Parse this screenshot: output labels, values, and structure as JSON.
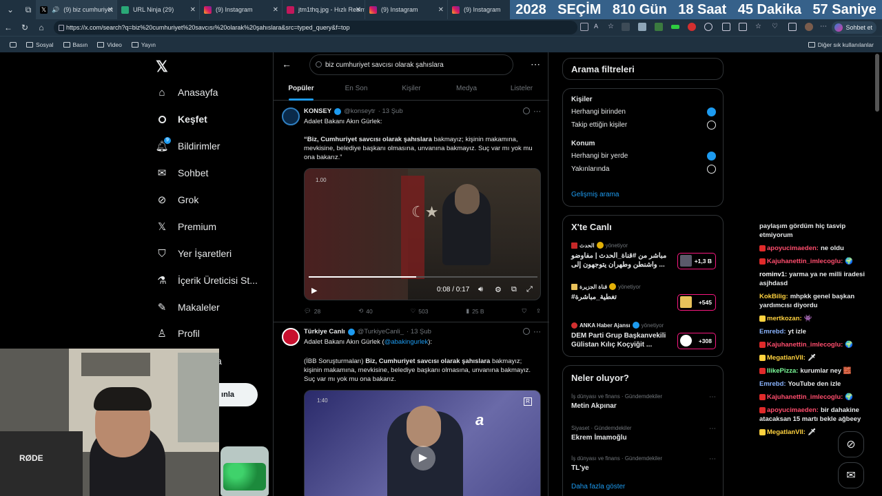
{
  "browser": {
    "tabs": [
      {
        "label": "(9) biz cumhuriyet",
        "favicon": "x-logo",
        "active": true
      },
      {
        "label": "URL Ninja (29)",
        "favicon": "urlninja-icon"
      },
      {
        "label": "(9) Instagram",
        "favicon": "instagram-icon"
      },
      {
        "label": "jtm1thq.jpg - Hızlı Resim",
        "favicon": "image-icon"
      },
      {
        "label": "(9) Instagram",
        "favicon": "instagram-icon"
      },
      {
        "label": "(9) Instagram",
        "favicon": "instagram-icon"
      }
    ],
    "url": "https://x.com/search?q=biz%20cumhuriyet%20savcısı%20olarak%20şahıslara&src=typed_query&f=top",
    "sohbet_label": "Sohbet et",
    "bookmarks": [
      "Sosyal",
      "Basın",
      "Video",
      "Yayın"
    ],
    "other_bookmarks": "Diğer sık kullanılanlar"
  },
  "countdown": {
    "year": "2028",
    "label": "SEÇİM",
    "days": "810 Gün",
    "hours": "18 Saat",
    "minutes": "45 Dakika",
    "seconds": "57 Saniye"
  },
  "nav": {
    "items": [
      {
        "label": "Anasayfa",
        "icon": "home-icon"
      },
      {
        "label": "Keşfet",
        "icon": "search-icon"
      },
      {
        "label": "Bildirimler",
        "icon": "bell-icon",
        "badge": "9"
      },
      {
        "label": "Sohbet",
        "icon": "mail-icon"
      },
      {
        "label": "Grok",
        "icon": "grok-icon"
      },
      {
        "label": "Premium",
        "icon": "x-icon"
      },
      {
        "label": "Yer İşaretleri",
        "icon": "bookmark-icon"
      },
      {
        "label": "İçerik Üreticisi St...",
        "icon": "flask-icon"
      },
      {
        "label": "Makaleler",
        "icon": "article-icon"
      },
      {
        "label": "Profil",
        "icon": "profile-icon"
      }
    ],
    "post_label_partial": "ınla",
    "more_partial": "a"
  },
  "search": {
    "query": "biz cumhuriyet savcısı olarak şahıslara"
  },
  "tabs": [
    "Popüler",
    "En Son",
    "Kişiler",
    "Medya",
    "Listeler"
  ],
  "tweets": [
    {
      "name": "KONSEY",
      "handle": "@konseytr",
      "date": "· 13 Şub",
      "line1": "Adalet Bakanı Akın Gürlek:",
      "quote_bold": "“Biz, Cumhuriyet savcısı olarak şahıslara",
      "quote_rest": " bakmayız; kişinin makamına, mevkisine, belediye başkanı olmasına, unvanına bakmayız. Suç var mı yok mu ona bakarız.”",
      "video": {
        "speed": "1.00",
        "time": "0:08 / 0:17",
        "progress": 0.47
      },
      "replies": "28",
      "reposts": "40",
      "likes": "503",
      "views": "25 B"
    },
    {
      "name": "Türkiye Canlı",
      "handle": "@TurkiyeCanli_",
      "date": "· 13 Şub",
      "line1_pre": "Adalet Bakanı Akın Gürlek (",
      "line1_mention": "@abakingurlek",
      "line1_post": "):",
      "body_pre": "(İBB Soruşturmaları) ",
      "body_bold": "Biz, Cumhuriyet savcısı olarak şahıslara",
      "body_rest": " bakmayız; kişinin makamına, mevkisine, belediye başkanı olmasına, unvanına bakmayız. Suç var mı yok mu ona bakarız.",
      "video_time": "1:40",
      "video_logo": "a"
    }
  ],
  "filters": {
    "title": "Arama filtreleri",
    "people_label": "Kişiler",
    "people_opts": [
      {
        "label": "Herhangi birinden",
        "selected": true
      },
      {
        "label": "Takip ettiğin kişiler",
        "selected": false
      }
    ],
    "location_label": "Konum",
    "location_opts": [
      {
        "label": "Herhangi bir yerde",
        "selected": true
      },
      {
        "label": "Yakınlarında",
        "selected": false
      }
    ],
    "advanced": "Gelişmiş arama"
  },
  "live": {
    "title": "X'te Canlı",
    "items": [
      {
        "source": "الحدث",
        "host": "yönetiyor",
        "title": "مباشر من #قناة_الحدث | مفاوضو واشنطن وطهران يتوجهون إلى ...",
        "count": "+1,3 B"
      },
      {
        "source": "قناة الجزيرة",
        "host": "yönetiyor",
        "title": "#تغطية_مباشرة",
        "count": "+545"
      },
      {
        "source": "ANKA Haber Ajansı",
        "host": "yönetiyor",
        "title": "DEM Parti Grup Başkanvekili Gülistan Kılıç Koçyiğit ...",
        "count": "+308"
      }
    ]
  },
  "trends": {
    "title": "Neler oluyor?",
    "items": [
      {
        "category": "İş dünyası ve finans · Gündemdekiler",
        "name": "Metin Akpınar"
      },
      {
        "category": "Siyaset · Gündemdekiler",
        "name": "Ekrem İmamoğlu"
      },
      {
        "category": "İş dünyası ve finans · Gündemdekiler",
        "name": "TL'ye"
      }
    ],
    "more": "Daha fazla göster"
  },
  "chat": [
    {
      "user": "",
      "text": "paylaşım gördüm hiç tasvip etmiyorum",
      "color": "#ffffff"
    },
    {
      "user": "apoyucimaeden:",
      "text": "ne oldu",
      "color": "#ff4d6d",
      "badge": "r"
    },
    {
      "user": "Kajuhanettin_imlecoglu:",
      "text": "🌍",
      "color": "#ff4d6d",
      "badge": "r"
    },
    {
      "user": "rominv1:",
      "text": "yarma ya ne milli iradesi asjhdasd",
      "color": "#ffffff"
    },
    {
      "user": "KokBilig:",
      "text": "mhpkk genel başkan yardımcısı diyordu",
      "color": "#ffd23f"
    },
    {
      "user": "mertkozan:",
      "text": "👾",
      "color": "#ffd23f",
      "badge": "y"
    },
    {
      "user": "Emrebd:",
      "text": "yt izle",
      "color": "#8ab4ff"
    },
    {
      "user": "Kajuhanettin_imlecoglu:",
      "text": "🌍",
      "color": "#ff4d6d",
      "badge": "r"
    },
    {
      "user": "MegatlanVII:",
      "text": "🗡",
      "color": "#ffd23f",
      "badge": "y"
    },
    {
      "user": "IlikePizza:",
      "text": "kurumlar ney 🧱",
      "color": "#7cfc9a",
      "badge": "r"
    },
    {
      "user": "Emrebd:",
      "text": "YouTube den izle",
      "color": "#8ab4ff"
    },
    {
      "user": "Kajuhanettin_imlecoglu:",
      "text": "🌍",
      "color": "#ff4d6d",
      "badge": "r"
    },
    {
      "user": "apoyucimaeden:",
      "text": "bir dahakine atacaksan 15 martı bekle ağbeey",
      "color": "#ff4d6d",
      "badge": "r"
    },
    {
      "user": "MegatlanVII:",
      "text": "🗡",
      "color": "#ffd23f",
      "badge": "y"
    }
  ],
  "webcam": {
    "mic_label": "RØDE"
  }
}
